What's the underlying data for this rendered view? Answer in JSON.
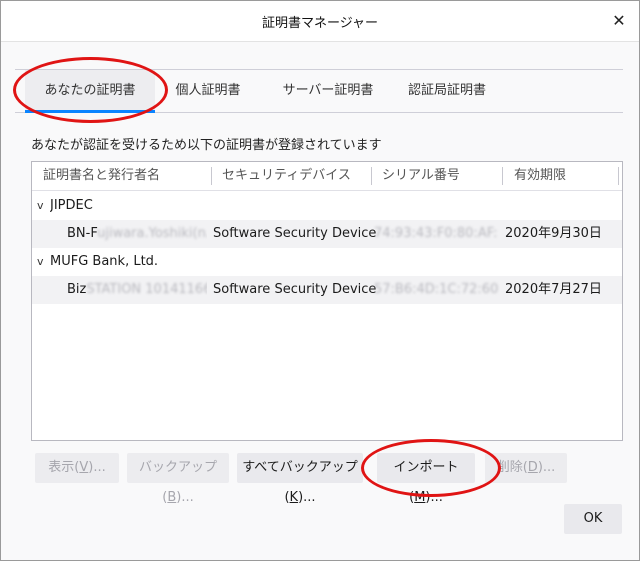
{
  "window": {
    "title": "証明書マネージャー",
    "close_glyph": "✕"
  },
  "tabs": [
    {
      "label": "あなたの証明書",
      "selected": true
    },
    {
      "label": "個人証明書",
      "selected": false
    },
    {
      "label": "サーバー証明書",
      "selected": false
    },
    {
      "label": "認証局証明書",
      "selected": false
    }
  ],
  "description": "あなたが認証を受けるため以下の証明書が登録されています",
  "table": {
    "columns": [
      "証明書名と発行者名",
      "セキュリティデバイス",
      "シリアル番号",
      "有効期限"
    ],
    "groups": [
      {
        "name": "JIPDEC",
        "expanded_glyph": "v",
        "rows": [
          {
            "name_prefix": "BN-F",
            "name_blurred": "ujiwara.Yoshiki(n...",
            "device": "Software Security Device",
            "serial_blurred": "74:93:43:F0:80:AF:C...",
            "expiry": "2020年9月30日"
          }
        ]
      },
      {
        "name": "MUFG Bank, Ltd.",
        "expanded_glyph": "v",
        "rows": [
          {
            "name_prefix": "Biz",
            "name_blurred": "STATION 10141166...",
            "device": "Software Security Device",
            "serial_blurred": "57:B6:4D:1C:72:60:3...",
            "expiry": "2020年7月27日"
          }
        ]
      }
    ]
  },
  "buttons": {
    "view": {
      "label": "表示(",
      "key": "V",
      "suffix": ")...",
      "enabled": false
    },
    "backup": {
      "label": "バックアップ(",
      "key": "B",
      "suffix": ")...",
      "enabled": false
    },
    "backup_all": {
      "label": "すべてバックアップ(",
      "key": "K",
      "suffix": ")...",
      "enabled": true
    },
    "import": {
      "label": "インポート(",
      "key": "M",
      "suffix": ")...",
      "enabled": true
    },
    "delete": {
      "label": "削除(",
      "key": "D",
      "suffix": ")...",
      "enabled": false
    },
    "ok": {
      "label": "OK",
      "enabled": true
    }
  },
  "colors": {
    "accent": "#0a84ff",
    "annotation": "#e01414"
  }
}
